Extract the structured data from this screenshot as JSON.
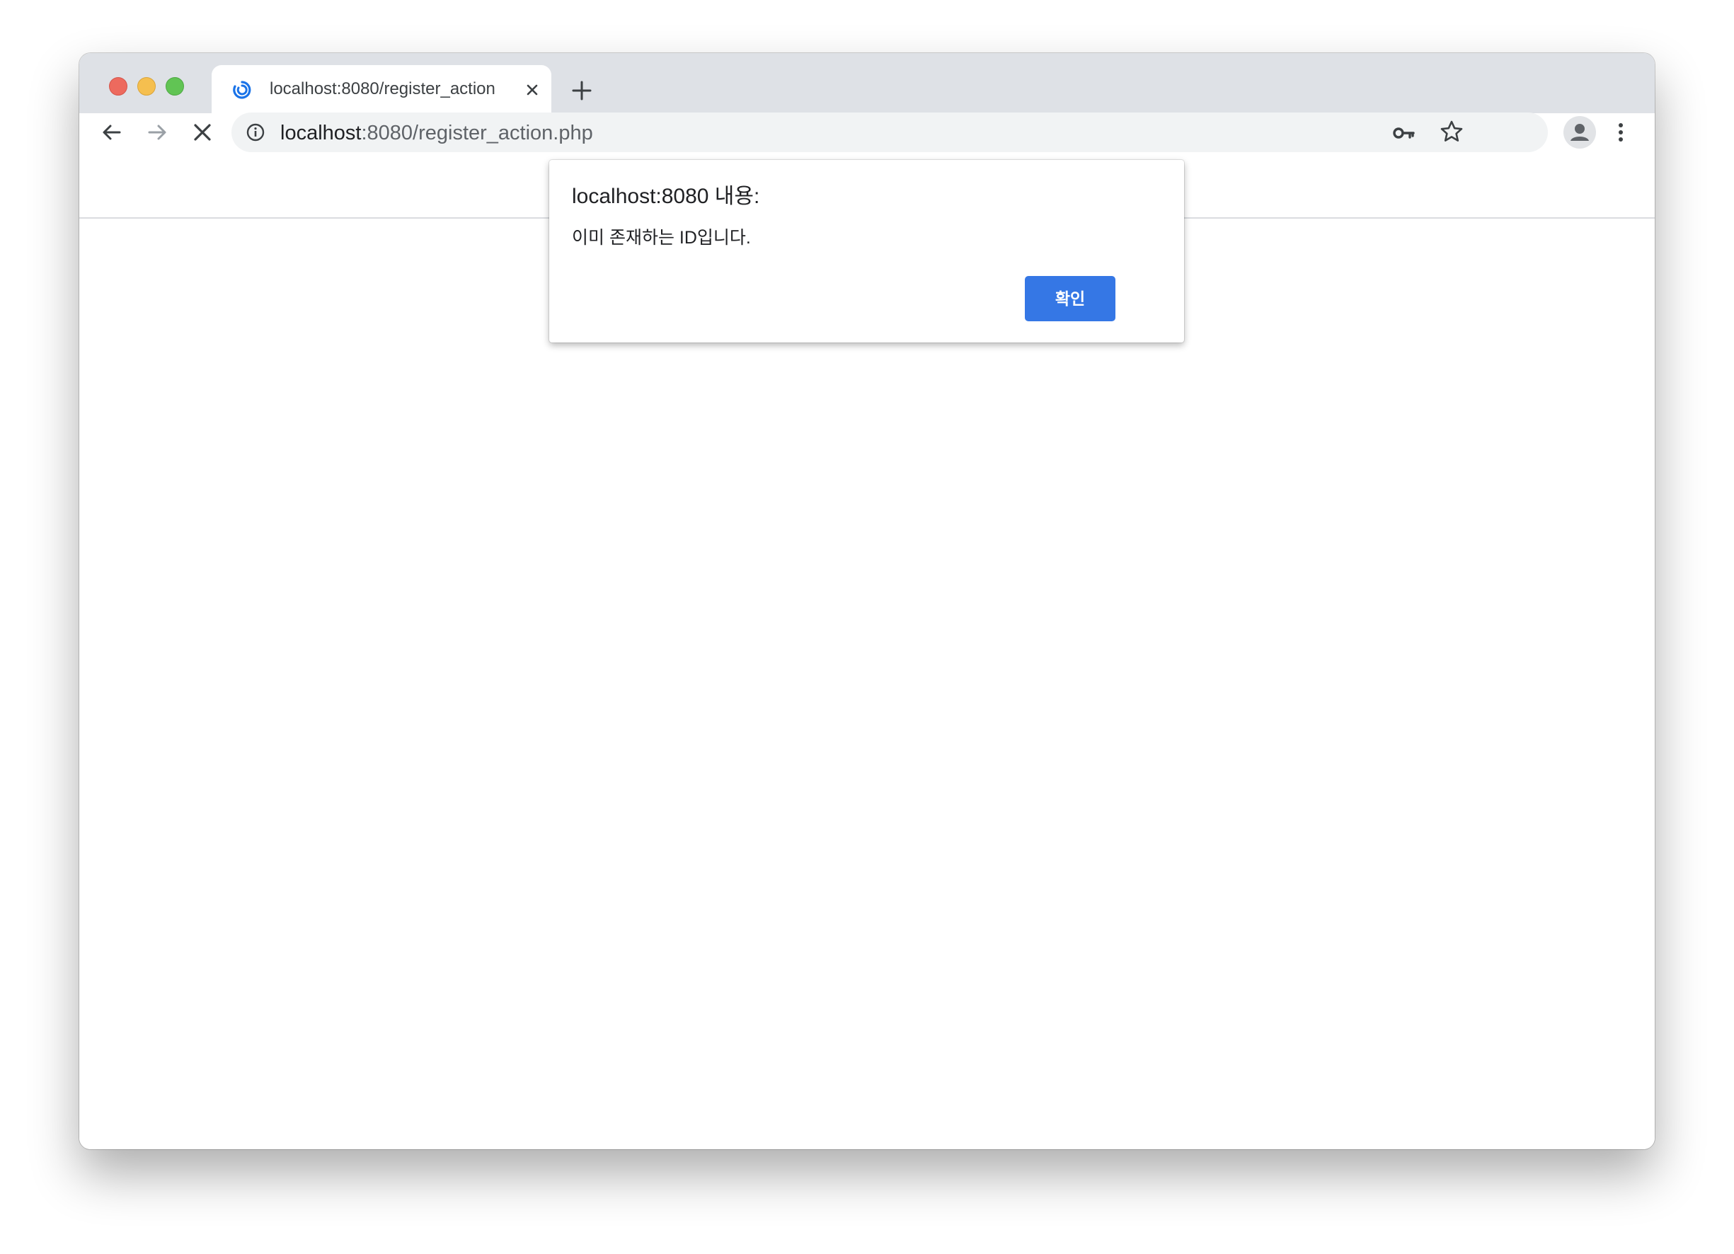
{
  "browser": {
    "tab": {
      "title": "localhost:8080/register_action",
      "favicon": "loading-spinner-icon",
      "close_icon": "close-icon"
    },
    "new_tab_icon": "plus-icon",
    "toolbar": {
      "back_icon": "arrow-left-icon",
      "forward_icon": "arrow-right-icon",
      "stop_icon": "close-icon",
      "url_host": "localhost",
      "url_rest": ":8080/register_action.php",
      "info_icon": "info-icon",
      "key_icon": "key-icon",
      "star_icon": "star-icon",
      "profile_icon": "person-icon",
      "menu_icon": "more-vertical-icon"
    },
    "colors": {
      "traffic_red": "#ed6a5e",
      "traffic_yellow": "#f5bf4f",
      "traffic_green": "#61c454",
      "accent": "#3577e5"
    }
  },
  "dialog": {
    "title": "localhost:8080 내용:",
    "message": "이미 존재하는 ID입니다.",
    "ok_label": "확인"
  }
}
